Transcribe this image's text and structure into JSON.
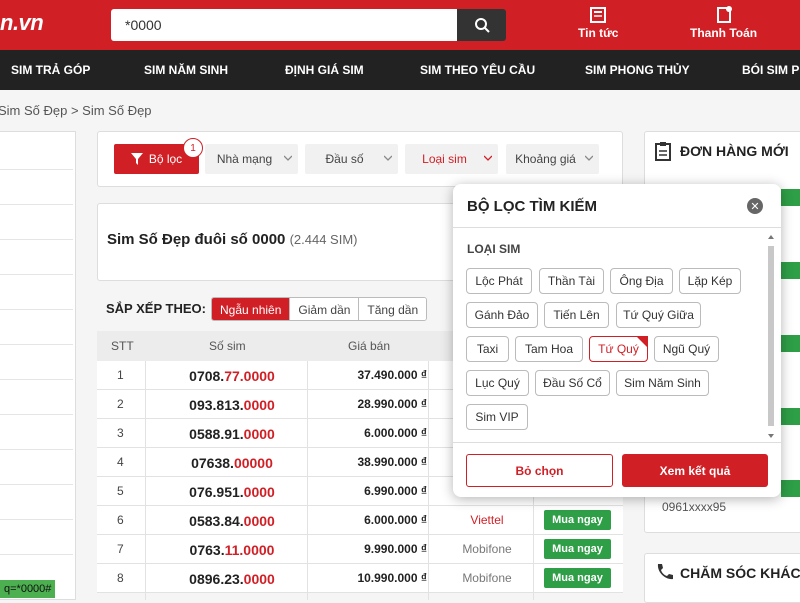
{
  "header": {
    "logo": "n.vn",
    "search_value": "*0000",
    "news_label": "Tin tức",
    "pay_label": "Thanh Toán"
  },
  "nav": [
    "SIM TRẢ GÓP",
    "SIM NĂM SINH",
    "ĐỊNH GIÁ SIM",
    "SIM THEO YÊU CẦU",
    "SIM PHONG THỦY",
    "BÓI SIM PH"
  ],
  "breadcrumb": "Sim Số Đẹp > Sim Số Đẹp",
  "filters": {
    "filter_btn": "Bộ lọc",
    "badge": "1",
    "network": "Nhà mạng",
    "prefix": "Đầu số",
    "type": "Loại sim",
    "price_range": "Khoảng giá"
  },
  "title": "Sim Số Đẹp đuôi số 0000",
  "count": "(2.444 SIM)",
  "sort": {
    "label": "SẮP XẾP THEO:",
    "options": [
      "Ngẫu nhiên",
      "Giảm dần",
      "Tăng dần"
    ]
  },
  "table": {
    "headers": [
      "STT",
      "Số sim",
      "Giá bán"
    ],
    "rows": [
      {
        "stt": "1",
        "prefix": "0708.",
        "mid": "77.",
        "tail": "0000",
        "price": "37.490.000 ₫",
        "network": "",
        "buy": ""
      },
      {
        "stt": "2",
        "prefix": "093.813.",
        "mid": "",
        "tail": "0000",
        "price": "28.990.000 ₫",
        "network": "",
        "buy": ""
      },
      {
        "stt": "3",
        "prefix": "0588.91.",
        "mid": "",
        "tail": "0000",
        "price": "6.000.000 ₫",
        "network": "",
        "buy": ""
      },
      {
        "stt": "4",
        "prefix": "07638.",
        "mid": "",
        "tail": "00000",
        "price": "38.990.000 ₫",
        "network": "",
        "buy": ""
      },
      {
        "stt": "5",
        "prefix": "076.951.",
        "mid": "",
        "tail": "0000",
        "price": "6.990.000 ₫",
        "network": "",
        "buy": ""
      },
      {
        "stt": "6",
        "prefix": "0583.84.",
        "mid": "",
        "tail": "0000",
        "price": "6.000.000 ₫",
        "network": "Viettel",
        "buy": "Mua ngay"
      },
      {
        "stt": "7",
        "prefix": "0763.",
        "mid": "11.",
        "tail": "0000",
        "price": "9.990.000 ₫",
        "network": "Mobifone",
        "buy": "Mua ngay"
      },
      {
        "stt": "8",
        "prefix": "0896.23.",
        "mid": "",
        "tail": "0000",
        "price": "10.990.000 ₫",
        "network": "Mobifone",
        "buy": "Mua ngay"
      }
    ]
  },
  "sidebar": {
    "orders_title": "ĐƠN HÀNG MỚI",
    "order_phone": "0961xxxx95",
    "care_title": "CHĂM SÓC KHÁCH H"
  },
  "left_tag": "q=*0000#",
  "popup": {
    "title": "BỘ LỌC TÌM KIẾM",
    "section": "LOẠI SIM",
    "chips": [
      "Lộc Phát",
      "Thần Tài",
      "Ông Địa",
      "Lặp Kép",
      "Gánh Đảo",
      "Tiến Lên",
      "Tứ Quý Giữa",
      "Taxi",
      "Tam Hoa",
      "Tứ Quý",
      "Ngũ Quý",
      "Lục Quý",
      "Đầu Số Cổ",
      "Sim Năm Sinh",
      "Sim VIP"
    ],
    "clear": "Bỏ chọn",
    "view": "Xem kết quả"
  },
  "colors": {
    "brand": "#d11f26",
    "buy": "#2e9e47",
    "dark": "#222222"
  }
}
